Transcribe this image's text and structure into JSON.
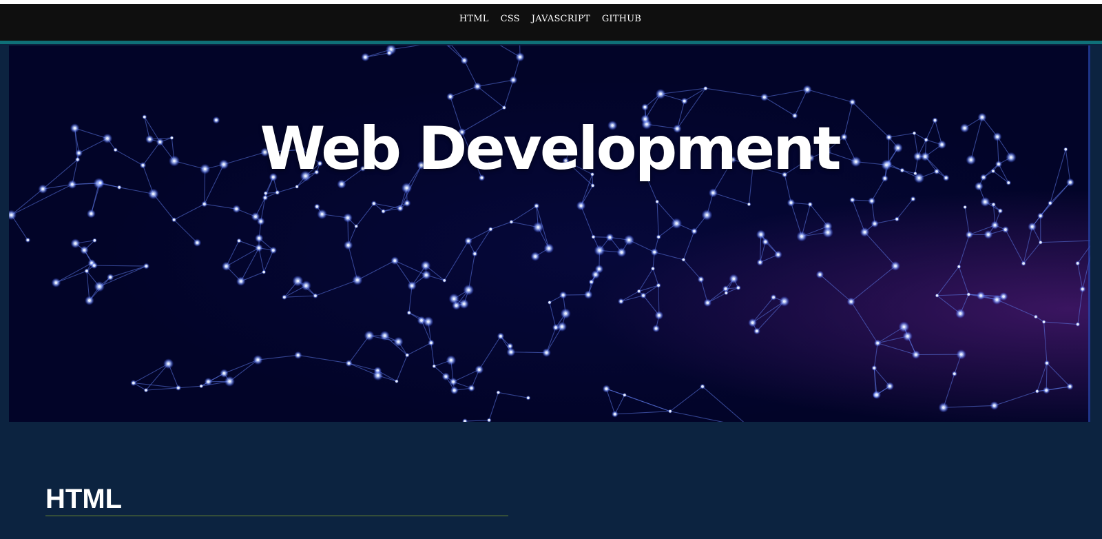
{
  "nav": {
    "links": [
      "HTML",
      "CSS",
      "JAVASCRIPT",
      "GITHUB"
    ]
  },
  "hero": {
    "title": "Web Development"
  },
  "sections": [
    {
      "heading": "HTML"
    }
  ],
  "colors": {
    "navbar": "#0f0f0f",
    "accent": "#0f7078",
    "page_background": "#0c2340",
    "rule": "#6f8a2e"
  }
}
